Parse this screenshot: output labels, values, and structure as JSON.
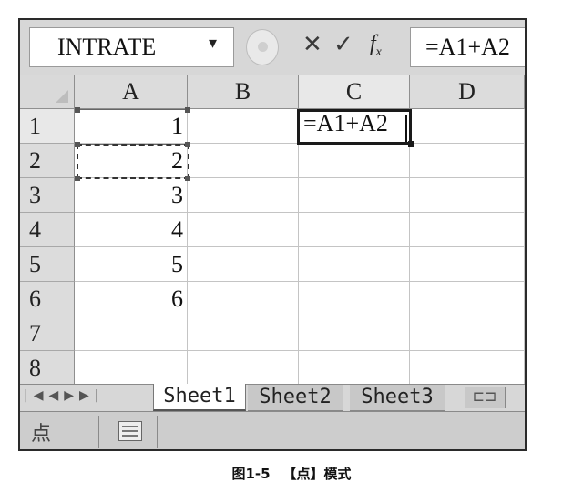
{
  "formula_bar": {
    "name_box": "INTRATE",
    "dropdown_glyph": "▾",
    "cancel_glyph": "✕",
    "enter_glyph": "✓",
    "fx_glyph": "f",
    "fx_sub": "x",
    "formula": "=A1+A2"
  },
  "grid": {
    "columns": [
      "A",
      "B",
      "C",
      "D"
    ],
    "rows": [
      "1",
      "2",
      "3",
      "4",
      "5",
      "6",
      "7",
      "8"
    ],
    "column_a_values": [
      "1",
      "2",
      "3",
      "4",
      "5",
      "6"
    ],
    "active_cell_text": "=A1+A2"
  },
  "sheets": {
    "nav_glyphs": "|◀◀▶▶|",
    "tabs": [
      "Sheet1",
      "Sheet2",
      "Sheet3"
    ]
  },
  "status_bar": {
    "mode": "点"
  },
  "caption": {
    "figure": "图1-5",
    "title": "【点】模式"
  }
}
